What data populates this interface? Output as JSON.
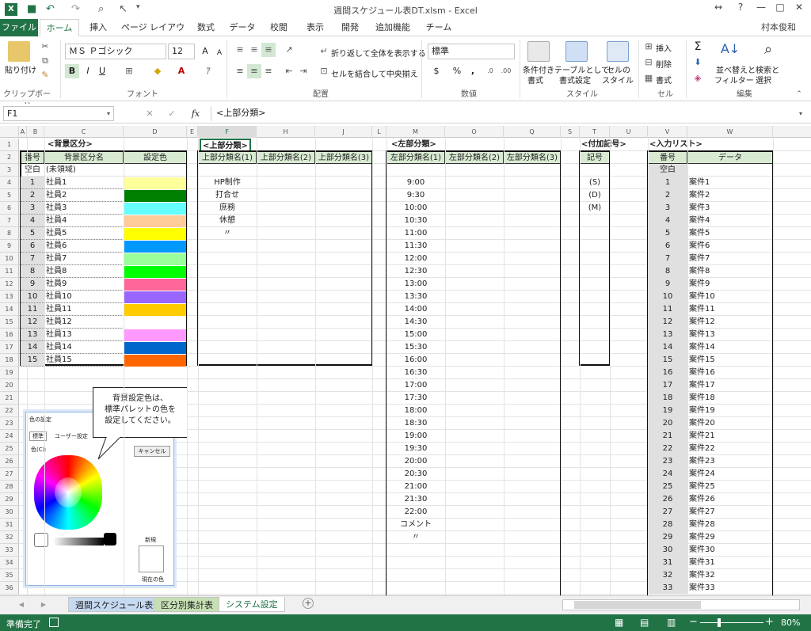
{
  "window": {
    "title": "週間スケジュール表DT.xlsm - Excel",
    "user": "村本俊和"
  },
  "tabs": [
    "ファイル",
    "ホーム",
    "挿入",
    "ページ レイアウト",
    "数式",
    "データ",
    "校閲",
    "表示",
    "開発",
    "追加機能",
    "チーム"
  ],
  "ribbon": {
    "clipboard": {
      "paste": "貼り付け",
      "label": "クリップボード"
    },
    "font": {
      "name": "ＭＳ Ｐゴシック",
      "size": "12",
      "bold": "B",
      "italic": "I",
      "underline": "U",
      "label": "フォント",
      "color_a": "A"
    },
    "alignment": {
      "wrap": "折り返して全体を表示する",
      "merge": "セルを結合して中央揃え",
      "label": "配置"
    },
    "number": {
      "format": "標準",
      "label": "数値",
      "currency": "$",
      "percent": "%",
      "comma": ","
    },
    "styles": {
      "cond": "条件付き",
      "cond2": "書式",
      "table": "テーブルとして",
      "table2": "書式設定",
      "cell": "セルの",
      "cell2": "スタイル",
      "label": "スタイル"
    },
    "cells": {
      "insert": "挿入",
      "delete": "削除",
      "format": "書式",
      "label": "セル"
    },
    "editing": {
      "sort": "並べ替えと",
      "sort2": "フィルター",
      "find": "検索と",
      "find2": "選択",
      "label": "編集"
    }
  },
  "formula_bar": {
    "name_box": "F1",
    "formula": "<上部分類>",
    "fx": "fx"
  },
  "columns": [
    "A",
    "B",
    "C",
    "D",
    "E",
    "F",
    "H",
    "J",
    "L",
    "M",
    "O",
    "Q",
    "S",
    "T",
    "U",
    "V",
    "W"
  ],
  "rows": [
    "1",
    "2",
    "3",
    "4",
    "5",
    "6",
    "7",
    "8",
    "9",
    "10",
    "11",
    "12",
    "13",
    "14",
    "15",
    "16",
    "17",
    "18",
    "19",
    "20",
    "21",
    "22",
    "23",
    "24",
    "25",
    "26",
    "27",
    "28",
    "29",
    "30",
    "31",
    "32",
    "33",
    "34",
    "35",
    "36"
  ],
  "bg_section": {
    "title": "<背景区分>",
    "h_num": "番号",
    "h_name": "背景区分名",
    "h_color": "設定色",
    "blank_num": "空白",
    "blank_name": "(未領域)",
    "items": [
      {
        "n": "1",
        "name": "社員1",
        "color": "#ffff99"
      },
      {
        "n": "2",
        "name": "社員2",
        "color": "#008000"
      },
      {
        "n": "3",
        "name": "社員3",
        "color": "#66ffff"
      },
      {
        "n": "4",
        "name": "社員4",
        "color": "#ffcc99"
      },
      {
        "n": "5",
        "name": "社員5",
        "color": "#ffff00"
      },
      {
        "n": "6",
        "name": "社員6",
        "color": "#0099ff"
      },
      {
        "n": "7",
        "name": "社員7",
        "color": "#99ff99"
      },
      {
        "n": "8",
        "name": "社員8",
        "color": "#00ff00"
      },
      {
        "n": "9",
        "name": "社員9",
        "color": "#ff6699"
      },
      {
        "n": "10",
        "name": "社員10",
        "color": "#9966ff"
      },
      {
        "n": "11",
        "name": "社員11",
        "color": "#ffcc00"
      },
      {
        "n": "12",
        "name": "社員12",
        "color": "#ffffff"
      },
      {
        "n": "13",
        "name": "社員13",
        "color": "#ff99ff"
      },
      {
        "n": "14",
        "name": "社員14",
        "color": "#0066cc"
      },
      {
        "n": "15",
        "name": "社員15",
        "color": "#ff6600"
      }
    ]
  },
  "top_section": {
    "title": "<上部分類>",
    "h1": "上部分類名(1)",
    "h2": "上部分類名(2)",
    "h3": "上部分類名(3)",
    "items": [
      "HP制作",
      "打合せ",
      "庶務",
      "休憩",
      "〃"
    ]
  },
  "left_section": {
    "title": "<左部分類>",
    "h1": "左部分類名(1)",
    "h2": "左部分類名(2)",
    "h3": "左部分類名(3)",
    "items": [
      "9:00",
      "9:30",
      "10:00",
      "10:30",
      "11:00",
      "11:30",
      "12:00",
      "12:30",
      "13:00",
      "13:30",
      "14:00",
      "14:30",
      "15:00",
      "15:30",
      "16:00",
      "16:30",
      "17:00",
      "17:30",
      "18:00",
      "18:30",
      "19:00",
      "19:30",
      "20:00",
      "20:30",
      "21:00",
      "21:30",
      "22:00",
      "コメント",
      "〃"
    ]
  },
  "mark_section": {
    "title": "<付加記号>",
    "h": "記号",
    "items": [
      "(S)",
      "(D)",
      "(M)"
    ]
  },
  "input_section": {
    "title": "<入力リスト>",
    "h_num": "番号",
    "h_data": "データ",
    "blank": "空白",
    "items": [
      "案件1",
      "案件2",
      "案件3",
      "案件4",
      "案件5",
      "案件6",
      "案件7",
      "案件8",
      "案件9",
      "案件10",
      "案件11",
      "案件12",
      "案件13",
      "案件14",
      "案件15",
      "案件16",
      "案件17",
      "案件18",
      "案件19",
      "案件20",
      "案件21",
      "案件22",
      "案件23",
      "案件24",
      "案件25",
      "案件26",
      "案件27",
      "案件28",
      "案件29",
      "案件30",
      "案件31",
      "案件32",
      "案件33"
    ]
  },
  "callout": {
    "l1": "背景設定色は、",
    "l2": "標準パレットの色を",
    "l3": "設定してください。"
  },
  "dialog": {
    "title": "色の設定",
    "tab1": "標準",
    "tab2": "ユーザー設定",
    "color_label": "色(C):",
    "cancel": "キャンセル",
    "new": "新規",
    "current": "現在の色"
  },
  "sheets": [
    "週間スケジュール表",
    "区分別集計表",
    "システム設定"
  ],
  "status": {
    "ready": "準備完了",
    "zoom": "80%"
  }
}
